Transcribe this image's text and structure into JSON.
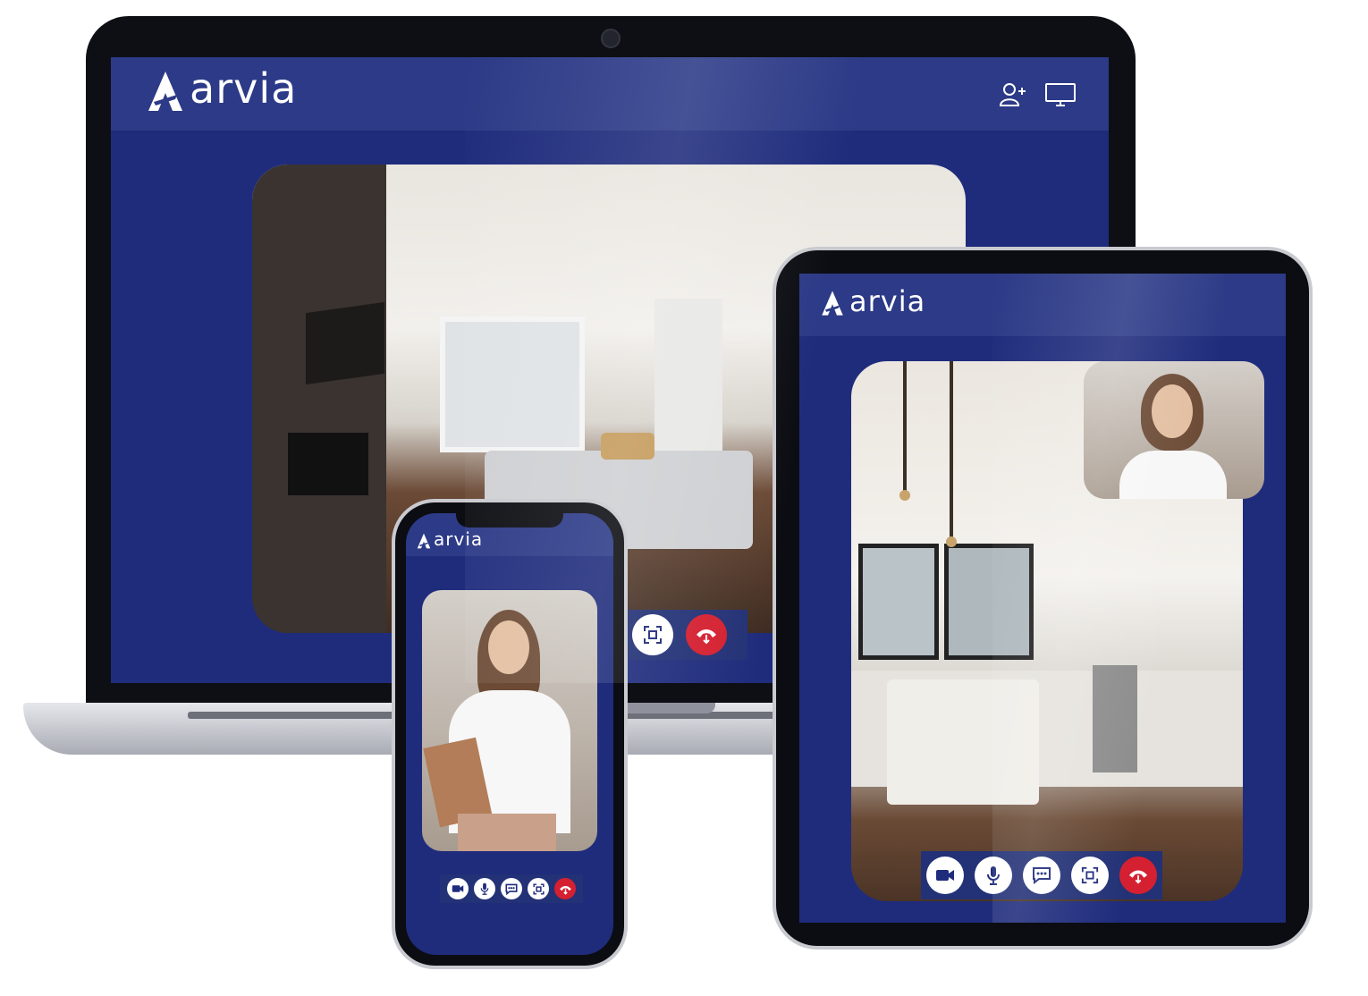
{
  "brand": {
    "name": "arvia",
    "background_color": "#1f2c7c",
    "header_color": "#2c3a87",
    "end_call_color": "#d42030"
  },
  "laptop": {
    "logo_text": "arvia",
    "header_icons": [
      "add-user-icon",
      "screen-share-icon"
    ],
    "controls": [
      "screenshot-icon",
      "end-call-icon"
    ]
  },
  "tablet": {
    "logo_text": "arvia",
    "controls": [
      "camera-icon",
      "microphone-icon",
      "chat-icon",
      "screenshot-icon",
      "end-call-icon"
    ]
  },
  "phone": {
    "logo_text": "arvia",
    "controls": [
      "camera-icon",
      "microphone-icon",
      "chat-icon",
      "screenshot-icon",
      "end-call-icon"
    ]
  }
}
